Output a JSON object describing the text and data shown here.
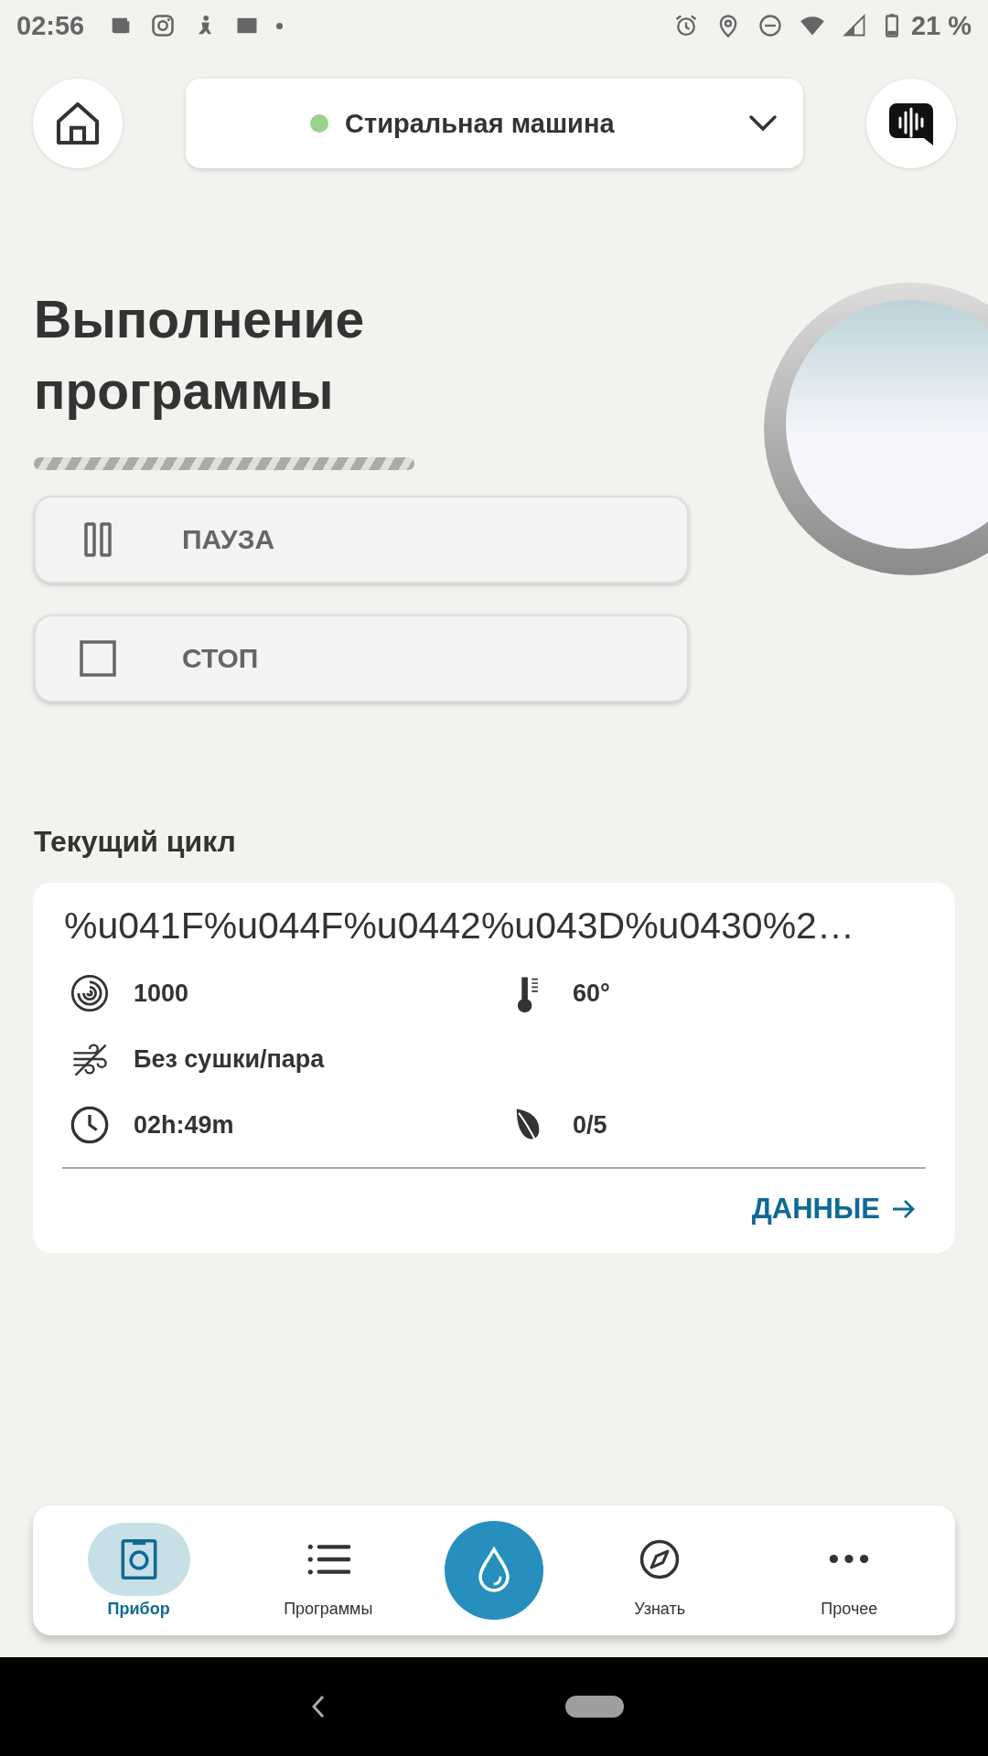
{
  "status_bar": {
    "time": "02:56",
    "battery": "21 %"
  },
  "header": {
    "device": "Стиральная машина",
    "connected": true
  },
  "title": "Выполнение программы",
  "progress": {
    "on": true
  },
  "controls": [
    {
      "kind": "pause",
      "label": "ПАУЗА"
    },
    {
      "kind": "stop",
      "label": "СТОП"
    }
  ],
  "section_title": "Текущий цикл",
  "cycle": {
    "program": "%u041F%u044F%u0442%u043D%u0430%2…",
    "details": [
      {
        "kind": "spin",
        "value": "1000"
      },
      {
        "kind": "temperature",
        "value": "60°"
      },
      {
        "kind": "drying",
        "value": "Без сушки/пара"
      },
      {
        "kind": "duration",
        "value": "02h:49m"
      },
      {
        "kind": "eco",
        "value": "0/5"
      }
    ],
    "link": "ДАННЫЕ"
  },
  "nav": [
    {
      "kind": "appliance",
      "label": "Прибор",
      "selected": true
    },
    {
      "kind": "programs",
      "label": "Программы",
      "selected": false
    },
    {
      "kind": "water",
      "selected": false
    },
    {
      "kind": "discover",
      "label": "Узнать",
      "selected": false
    },
    {
      "kind": "more",
      "label": "Прочее",
      "selected": false
    }
  ]
}
